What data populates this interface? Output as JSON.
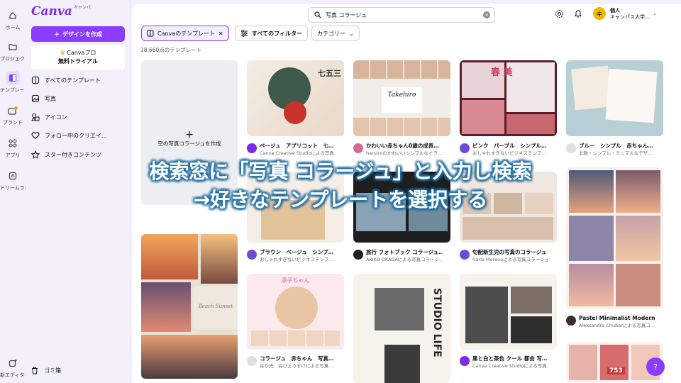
{
  "rail": {
    "items": [
      {
        "label": "ホーム",
        "icon": "home-icon"
      },
      {
        "label": "プロジェクト",
        "icon": "folder-icon"
      },
      {
        "label": "テンプレート",
        "icon": "template-icon"
      },
      {
        "label": "ブランド",
        "icon": "brand-icon"
      },
      {
        "label": "アプリ",
        "icon": "apps-icon"
      },
      {
        "label": "ドリームラボ",
        "icon": "dream-lab-icon"
      }
    ],
    "bottom": {
      "label": "新エディター",
      "icon": "new-editor-icon"
    }
  },
  "sidebar": {
    "logo": "Canva",
    "logo_sub": "キャンバ",
    "create_button": "デザインを作成",
    "pro_title": "Canvaプロ",
    "pro_sub": "無料トライアル",
    "nav": [
      {
        "label": "すべてのテンプレート",
        "icon": "template-icon"
      },
      {
        "label": "写真",
        "icon": "photo-icon"
      },
      {
        "label": "アイコン",
        "icon": "shapes-icon"
      },
      {
        "label": "フォロー中のクリエイ…",
        "icon": "heart-icon"
      },
      {
        "label": "スター付きコンテンツ",
        "icon": "star-icon"
      }
    ],
    "trash": "ゴミ箱"
  },
  "header": {
    "search_value": "写真 コラージュ",
    "account_type": "個人",
    "account_name": "キャンパス大学…",
    "avatar_initial": "キ"
  },
  "filters": {
    "chip_selected": "Canvaのテンプレート",
    "chip_all": "すべてのフィルター",
    "chip_category": "カテゴリー"
  },
  "result_count": "18,660点のテンプレート",
  "blank_card": "空の写真コラージュを作成",
  "cards": [
    {
      "title": "ベージュ　アプリコット　七…",
      "sub": "Canva Creative Studioによる写真…",
      "tag": "七五三"
    },
    {
      "title": "かわいい赤ちゃん0歳の成長…",
      "sub": "haruiroのかわいいシンプルなイラ…",
      "tag": "Takehiro"
    },
    {
      "title": "ピンク　パープル　シンプル…",
      "sub": "おしゃれすぎないビジネステンプ…",
      "tag": "春 美"
    },
    {
      "title": "ブルー　シンプル　赤ちゃん…",
      "sub": "北欧・シンプル・ミニマルなデザ…",
      "tag": ""
    },
    {
      "title": "ブラウン　ベージュ　シンプ…",
      "sub": "おしゃれすぎないビジネステンプ…",
      "tag": ""
    },
    {
      "title": "旅行 フォトブック コラージュ…",
      "sub": "AKIKO OKADAによる写真コラージ…",
      "tag": ""
    },
    {
      "title": "匂配新生児の写真のコラージュ",
      "sub": "Carla Morenoによる写真コラージュ",
      "tag": ""
    },
    {
      "title": "Pastel Minimalist Modern T…",
      "sub": "Aleksandra Chubarによる写真コ…",
      "tag": ""
    },
    {
      "title": "コラージュ　赤ちゃん　写真…",
      "sub": "谷か光　谷ひょうすけによる写真…",
      "tag": "凛子ちゃん"
    },
    {
      "title": "黒と白と茶色 クール 都会 写…",
      "sub": "Canva Creative Studioによる写真…",
      "tag": ""
    },
    {
      "title": "Beach Sunset",
      "sub": "",
      "tag": ""
    },
    {
      "title": "STUDIO LIFE",
      "sub": "",
      "tag": ""
    },
    {
      "title": "753",
      "sub": "",
      "tag": ""
    }
  ],
  "overlay": {
    "line1": "検索窓に「写真 コラージュ」と入力し検索",
    "line2": "→好きなテンプレートを選択する"
  },
  "help_label": "?",
  "colors": {
    "accent": "#8b3dff",
    "overlay_outline": "#2a7fb8"
  }
}
